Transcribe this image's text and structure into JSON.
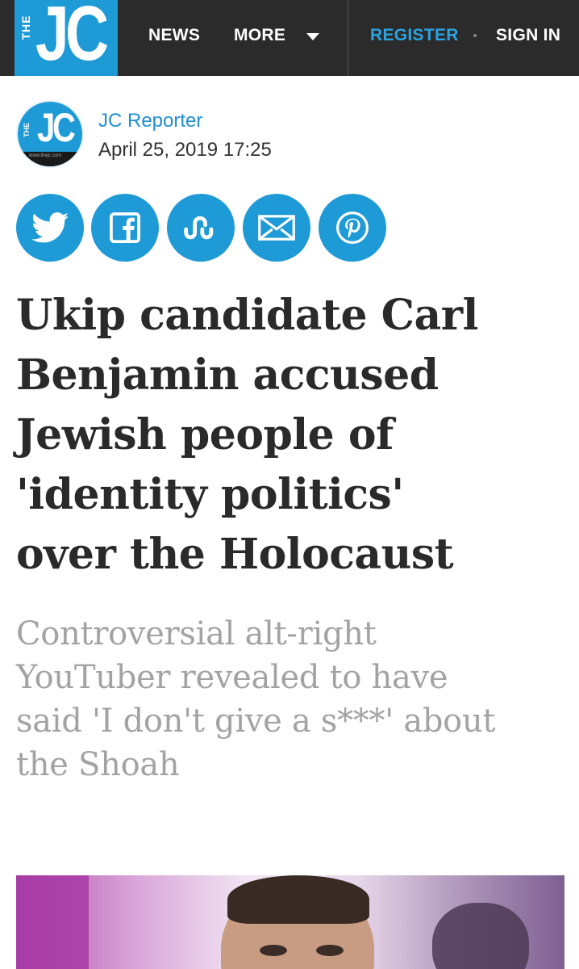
{
  "header": {
    "logo": {
      "small_text": "THE",
      "main_text": "JC"
    },
    "nav": {
      "news": "NEWS",
      "more": "MORE",
      "register": "REGISTER",
      "sign_in": "SIGN IN"
    }
  },
  "byline": {
    "author": "JC Reporter",
    "date": "April 25, 2019 17:25",
    "avatar": {
      "small_text": "THE",
      "main_text": "JC",
      "url": "www.thejc.com"
    }
  },
  "share": [
    {
      "icon": "twitter-icon"
    },
    {
      "icon": "facebook-icon"
    },
    {
      "icon": "stumbleupon-icon"
    },
    {
      "icon": "email-icon"
    },
    {
      "icon": "pinterest-icon"
    }
  ],
  "article": {
    "headline_lines": [
      "Ukip candidate Carl",
      "Benjamin accused",
      "Jewish people of",
      "'identity politics'",
      "over the Holocaust"
    ],
    "standfirst_lines": [
      "Controversial alt-right",
      "YouTuber revealed to have",
      "said 'I don't give a s***' about",
      "the Shoah"
    ]
  },
  "colors": {
    "brand_blue": "#1e9ad6",
    "header_bg": "#2b2b2b",
    "register_blue": "#2aa3e0",
    "standfirst_grey": "#a3a3a3"
  }
}
